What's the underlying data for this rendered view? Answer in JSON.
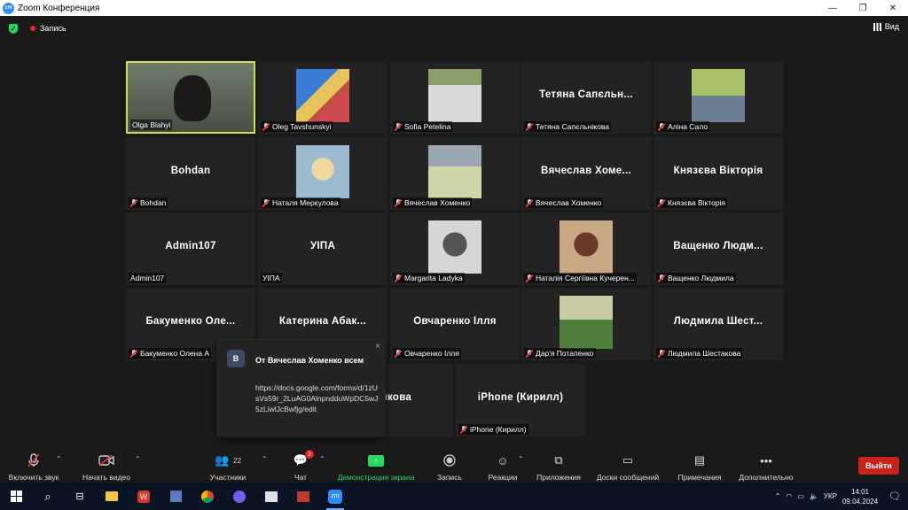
{
  "window": {
    "title": "Zoom Конференция",
    "logo": "zm"
  },
  "topbar": {
    "recording": "Запись",
    "view": "Вид"
  },
  "tiles": [
    {
      "name": "Olga Blahyi",
      "big": "",
      "muted": false,
      "video": true,
      "active": true
    },
    {
      "name": "Oleg Tavshunskyi",
      "big": "",
      "muted": true,
      "photo": "map"
    },
    {
      "name": "Sofia Petelina",
      "big": "",
      "muted": true,
      "photo": "desk"
    },
    {
      "name": "Тетяна Сапєльнікова",
      "big": "Тетяна  Сапєльн...",
      "muted": true
    },
    {
      "name": "Аліна Сало",
      "big": "",
      "muted": true,
      "photo": "street"
    },
    {
      "name": "Bohdan",
      "big": "Bohdan",
      "muted": true
    },
    {
      "name": "Наталя Меркулова",
      "big": "",
      "muted": true,
      "photo": "blonde"
    },
    {
      "name": "Вячеслав Хоменко",
      "big": "",
      "muted": true,
      "photo": "crowd"
    },
    {
      "name": "Вячеслав Хоменко",
      "big": "Вячеслав  Хоме...",
      "muted": true
    },
    {
      "name": "Князєва Вікторія",
      "big": "Князєва  Вікторія",
      "muted": true
    },
    {
      "name": "Admin107",
      "big": "Admin107",
      "muted": false
    },
    {
      "name": "УІПА",
      "big": "УІПА",
      "muted": false
    },
    {
      "name": "Margarita Ladyka",
      "big": "",
      "muted": true,
      "photo": "bw"
    },
    {
      "name": "Наталія Сергіївна Кучерен...",
      "big": "",
      "muted": true,
      "photo": "girl"
    },
    {
      "name": "Ващенко Людмила",
      "big": "Ващенко  Людм...",
      "muted": true
    },
    {
      "name": "Бакуменко Олена А",
      "big": "Бакуменко  Оле...",
      "muted": true
    },
    {
      "name": "",
      "big": "Катерина  Абак...",
      "muted": false
    },
    {
      "name": "Овчаренко Ілля",
      "big": "Овчаренко Ілля",
      "muted": true
    },
    {
      "name": "Дар'я Потапенко",
      "big": "",
      "muted": true,
      "photo": "outdoor"
    },
    {
      "name": "Людмила Шестакова",
      "big": "Людмила  Шест...",
      "muted": true
    },
    {
      "name": "ва",
      "big": "Пашкова",
      "muted": false
    },
    {
      "name": "iPhone (Кирилл)",
      "big": "iPhone (Кирилл)",
      "muted": true
    }
  ],
  "chat_popup": {
    "avatar": "В",
    "from": "От Вячеслав Хоменко всем",
    "message": "https://docs.google.com/forms/d/1zUsVs59r_2LuAG0AlnpndduWpDC5wJ5zLiwlJcBwfjg/edit",
    "close": "×"
  },
  "toolbar": {
    "audio": "Включить звук",
    "video": "Начать видео",
    "participants": "Участники",
    "participants_count": "22",
    "chat": "Чат",
    "chat_badge": "2",
    "share": "Демонстрация экрана",
    "record": "Запись",
    "reactions": "Реакции",
    "apps": "Приложения",
    "whiteboards": "Доски сообщений",
    "notes": "Примечания",
    "more": "Дополнительно",
    "leave": "Выйти"
  },
  "taskbar": {
    "lang": "УКР",
    "time": "14:01",
    "date": "09.04.2024"
  }
}
